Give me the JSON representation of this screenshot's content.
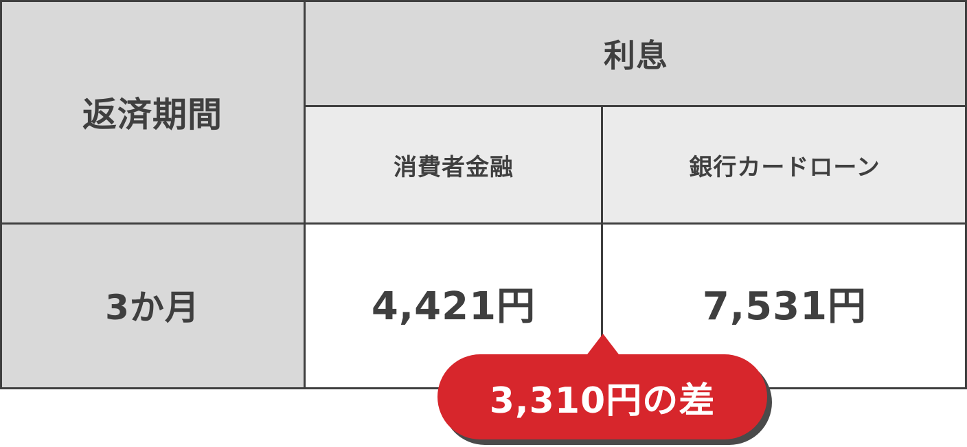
{
  "table": {
    "header": {
      "period": "返済期間",
      "interest": "利息",
      "consumer_finance": "消費者金融",
      "bank_card_loan": "銀行カードローン"
    },
    "rows": [
      {
        "period": "3か月",
        "consumer_finance": "4,421円",
        "bank_card_loan": "7,531円"
      }
    ]
  },
  "callout": {
    "text": "3,310円の差",
    "color": "#d7262c"
  },
  "colors": {
    "header_dark": "#d9d9d9",
    "header_light": "#ebebeb",
    "border": "#3f3f3f",
    "text": "#3f3f3f"
  }
}
